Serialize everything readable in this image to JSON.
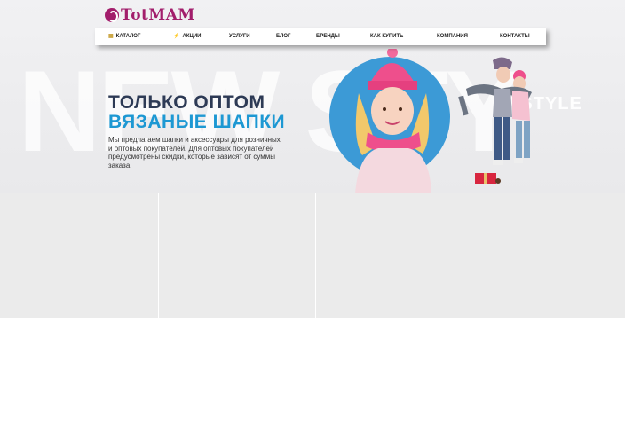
{
  "logo": {
    "text": "TotMAM"
  },
  "nav": {
    "items": [
      {
        "label": "Каталог",
        "icon": "grid-icon"
      },
      {
        "label": "Акции",
        "icon": "bolt-icon"
      },
      {
        "label": "Услуги"
      },
      {
        "label": "Блог"
      },
      {
        "label": "Бренды"
      },
      {
        "label": "Как купить"
      },
      {
        "label": "Компания"
      },
      {
        "label": "Контакты"
      }
    ]
  },
  "hero": {
    "watermark": "NEW STY",
    "watermark_small": "W STYLE",
    "title": "ТОЛЬКО ОПТОМ",
    "subtitle": "ВЯЗАНЫЕ ШАПКИ",
    "description": "Мы предлагаем шапки и аксессуары для розничных и оптовых покупателей. Для оптовых покупателей предусмотрены скидки, которые зависят от суммы заказа.",
    "colors": {
      "title": "#2d3a55",
      "subtitle": "#1d98d3",
      "circle": "#3c9ad6",
      "brand": "#a21d6b"
    }
  }
}
